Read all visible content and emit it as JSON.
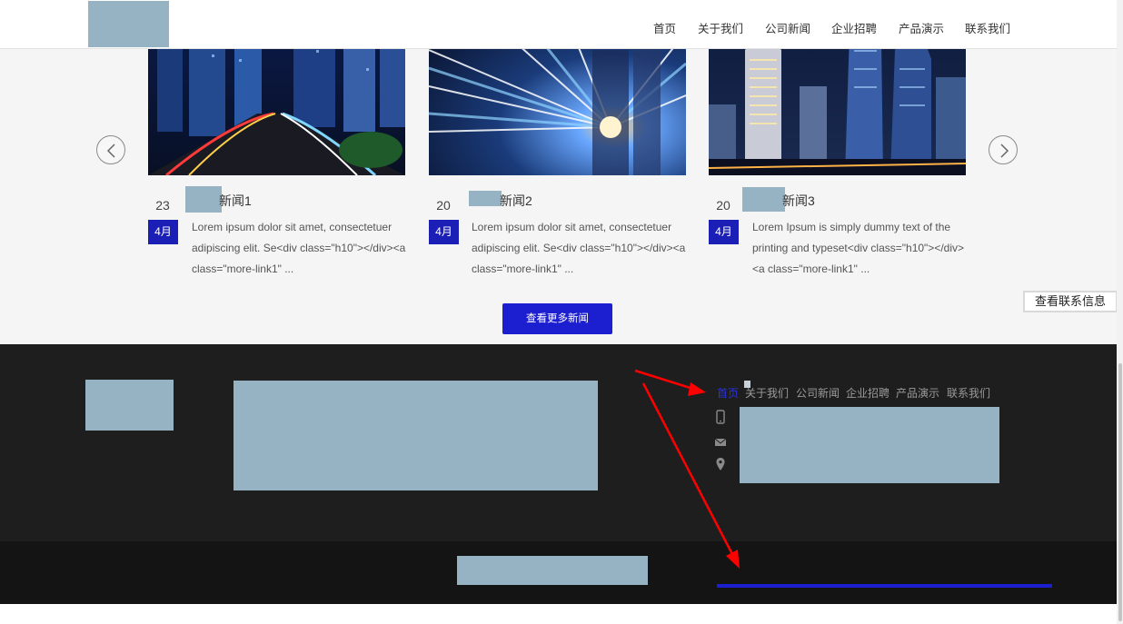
{
  "header": {
    "nav": [
      "首页",
      "关于我们",
      "公司新闻",
      "企业招聘",
      "产品演示",
      "联系我们"
    ]
  },
  "news": [
    {
      "day": "23",
      "month": "4月",
      "title": "新闻1",
      "desc": "Lorem ipsum dolor sit amet, consectetuer adipiscing elit. Se<div class=\"h10\"></div><a class=\"more-link1\" ..."
    },
    {
      "day": "20",
      "month": "4月",
      "title": "新闻2",
      "desc": "Lorem ipsum dolor sit amet, consectetuer adipiscing elit. Se<div class=\"h10\"></div><a class=\"more-link1\" ..."
    },
    {
      "day": "20",
      "month": "4月",
      "title": "新闻3",
      "desc": "Lorem Ipsum is simply dummy text of the printing and typeset<div class=\"h10\"></div><a class=\"more-link1\" ..."
    }
  ],
  "more_button": "查看更多新闻",
  "contact_tab": "查看联系信息",
  "footer": {
    "nav": [
      "首页",
      "关于我们",
      "公司新闻",
      "企业招聘",
      "产品演示",
      "联系我们"
    ],
    "active_index": 0,
    "icons": [
      "phone-icon",
      "mail-icon",
      "location-icon"
    ]
  },
  "colors": {
    "accent": "#1c1fd0",
    "footer_bg": "#1e1e1e",
    "footer_bottom_bg": "#141414",
    "placeholder": "#96b3c3",
    "annotation": "#ff0000"
  }
}
